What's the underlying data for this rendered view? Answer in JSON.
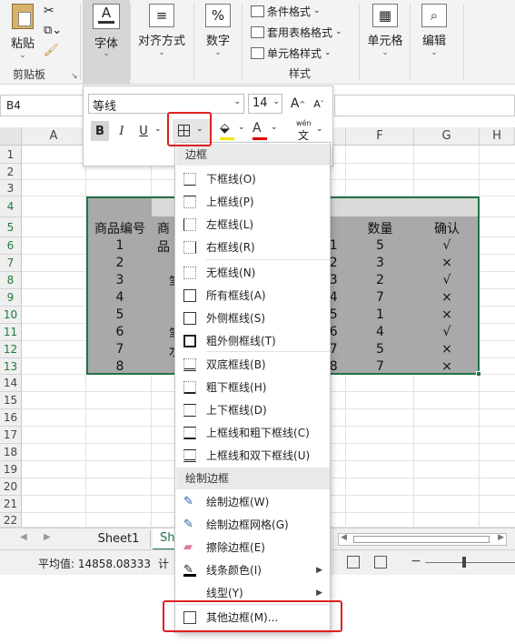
{
  "ribbon": {
    "paste_label": "粘贴",
    "clipboard_group": "剪贴板",
    "font_label": "字体",
    "align_label": "对齐方式",
    "number_label": "数字",
    "cond_format": "条件格式",
    "table_format": "套用表格格式",
    "cell_style": "单元格样式",
    "styles_group": "样式",
    "cells_label": "单元格",
    "edit_label": "编辑",
    "number_icon": "%"
  },
  "namebox": {
    "value": "B4"
  },
  "mini_toolbar": {
    "font_name": "等线",
    "font_size": "14",
    "bold": "B",
    "italic": "I",
    "underline": "U",
    "grow": "A",
    "shrink": "A",
    "wen": "wén"
  },
  "columns": [
    "A",
    "B",
    "C",
    "D",
    "E",
    "F",
    "G",
    "H"
  ],
  "rows": [
    "1",
    "2",
    "3",
    "4",
    "5",
    "6",
    "7",
    "8",
    "9",
    "10",
    "11",
    "12",
    "13",
    "14",
    "15",
    "16",
    "17",
    "18",
    "19",
    "20",
    "21",
    "22"
  ],
  "sheet": {
    "headers": {
      "code": "商品编号",
      "name_partial": "商品",
      "qty": "数量",
      "confirm": "确认"
    },
    "data": [
      {
        "code": "1",
        "mid": "",
        "date": "/1",
        "qty": "5",
        "ok": "√"
      },
      {
        "code": "2",
        "mid": "",
        "date": "/2",
        "qty": "3",
        "ok": "×"
      },
      {
        "code": "3",
        "mid": "笔",
        "date": "/3",
        "qty": "2",
        "ok": "√"
      },
      {
        "code": "4",
        "mid": "",
        "date": "/4",
        "qty": "7",
        "ok": "×"
      },
      {
        "code": "5",
        "mid": "",
        "date": "/5",
        "qty": "1",
        "ok": "×"
      },
      {
        "code": "6",
        "mid": "笔",
        "date": "/6",
        "qty": "4",
        "ok": "√"
      },
      {
        "code": "7",
        "mid": "水",
        "date": "/7",
        "qty": "5",
        "ok": "×"
      },
      {
        "code": "8",
        "mid": "",
        "date": "/8",
        "qty": "7",
        "ok": "×"
      }
    ]
  },
  "tabs": {
    "sheet1": "Sheet1",
    "sheet2_partial": "Sh"
  },
  "status": {
    "average": "平均值: 14858.08333",
    "count_partial": "计"
  },
  "menu": {
    "border_section": "边框",
    "items1": [
      {
        "label": "下框线",
        "key": "(O)"
      },
      {
        "label": "上框线",
        "key": "(P)"
      },
      {
        "label": "左框线",
        "key": "(L)"
      },
      {
        "label": "右框线",
        "key": "(R)"
      }
    ],
    "items2": [
      {
        "label": "无框线",
        "key": "(N)"
      },
      {
        "label": "所有框线",
        "key": "(A)"
      },
      {
        "label": "外侧框线",
        "key": "(S)"
      },
      {
        "label": "粗外侧框线",
        "key": "(T)"
      }
    ],
    "items3": [
      {
        "label": "双底框线",
        "key": "(B)"
      },
      {
        "label": "粗下框线",
        "key": "(H)"
      },
      {
        "label": "上下框线",
        "key": "(D)"
      },
      {
        "label": "上框线和粗下框线",
        "key": "(C)"
      },
      {
        "label": "上框线和双下框线",
        "key": "(U)"
      }
    ],
    "draw_section": "绘制边框",
    "items4": [
      {
        "label": "绘制边框",
        "key": "(W)"
      },
      {
        "label": "绘制边框网格",
        "key": "(G)"
      },
      {
        "label": "擦除边框",
        "key": "(E)"
      },
      {
        "label": "线条颜色",
        "key": "(I)"
      },
      {
        "label": "线型",
        "key": "(Y)"
      }
    ],
    "more_borders": "其他边框",
    "more_key": "(M)..."
  },
  "colors": {
    "accent_green": "#217346",
    "highlight_red": "#e02020",
    "range_fill": "#a9a9a9"
  }
}
